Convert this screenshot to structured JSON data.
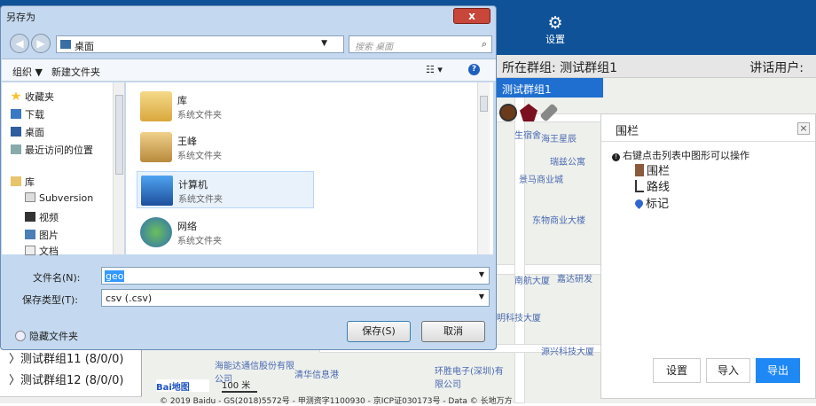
{
  "app": {
    "settings_label": "设置",
    "group_label": "所在群组: 测试群组1",
    "talk_user_label": "讲话用户:",
    "group_title": "测试群组1"
  },
  "group_list": [
    "测试群组11 (8/0/0)",
    "测试群组12 (8/0/0)"
  ],
  "map": {
    "pois": [
      "海王星辰",
      "瑞兹公寓",
      "景马商业城",
      "东物商业大楼",
      "南航大厦",
      "嘉达研发",
      "明科技大厦",
      "源兴科技大厦",
      "海能达通信股份有限公司",
      "清华信息港",
      "环胜电子(深圳)有限公司",
      "生宿舍"
    ],
    "scale_label": "100 米",
    "copyright": "© 2019 Baidu - GS(2018)5572号 - 甲测资字1100930 - 京ICP证030173号 - Data © 长地万方",
    "logo": "Bai地图"
  },
  "fence_panel": {
    "title": "围栏",
    "close": "×",
    "hint": "右键点击列表中图形可以操作",
    "items": [
      "围栏",
      "路线",
      "标记"
    ],
    "buttons": {
      "settings": "设置",
      "import": "导入",
      "export": "导出"
    }
  },
  "dialog": {
    "title": "另存为",
    "close": "x",
    "address": "桌面",
    "search_placeholder": "搜索 桌面",
    "organize": "组织 ▼",
    "new_folder": "新建文件夹",
    "sidebar": [
      "收藏夹",
      "下载",
      "桌面",
      "最近访问的位置",
      "库",
      "Subversion",
      "视频",
      "图片",
      "文档"
    ],
    "files": [
      {
        "name": "库",
        "type": "系统文件夹"
      },
      {
        "name": "王峰",
        "type": "系统文件夹"
      },
      {
        "name": "计算机",
        "type": "系统文件夹"
      },
      {
        "name": "网络",
        "type": "系统文件夹"
      }
    ],
    "filename_label": "文件名(N):",
    "filename_value": "geo",
    "filetype_label": "保存类型(T):",
    "filetype_value": "csv (.csv)",
    "hide_folders": "隐藏文件夹",
    "save": "保存(S)",
    "cancel": "取消"
  },
  "colors": {
    "topbar": "#0f5298",
    "accent": "#1f6fd0",
    "export": "#1e88f5"
  }
}
